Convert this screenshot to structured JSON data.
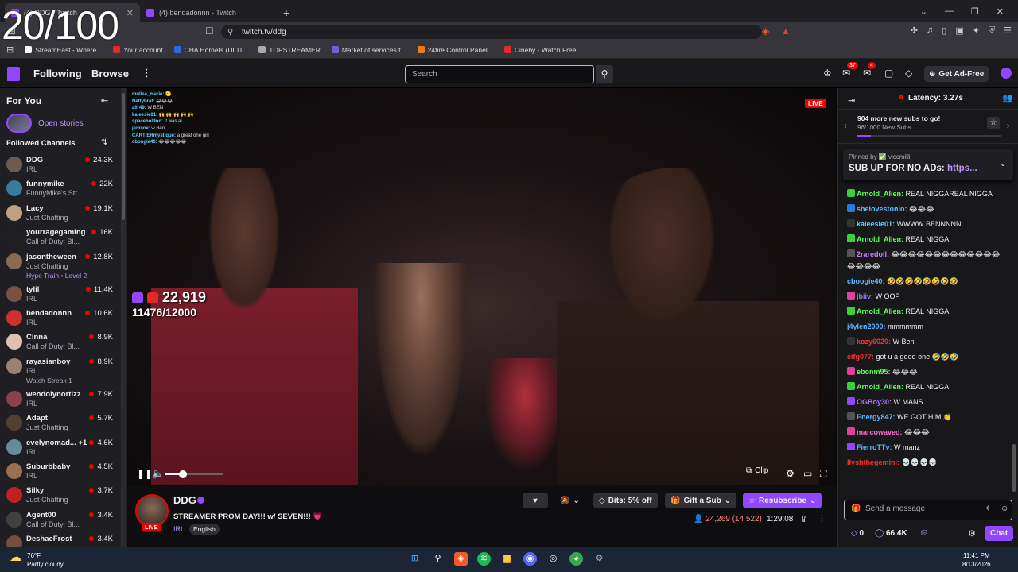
{
  "overlay_counter": "20/100",
  "browser": {
    "tabs": [
      {
        "label": "(4) DDG - Twitch",
        "active": true
      },
      {
        "label": "(4) bendadonnn - Twitch",
        "active": false
      }
    ],
    "new_tab": "+",
    "url": "twitch.tv/ddg",
    "bookmarks": [
      {
        "label": "StreamEast - Where...",
        "color": "#ffffff"
      },
      {
        "label": "Your account",
        "color": "#e52828"
      },
      {
        "label": "CHA Hornets (ULTI...",
        "color": "#2a6be0"
      },
      {
        "label": "TOPSTREAMER",
        "color": "#aaaaaa"
      },
      {
        "label": "Market of services f...",
        "color": "#7a5ae0"
      },
      {
        "label": "24fire Control Panel...",
        "color": "#f07a1a"
      },
      {
        "label": "Cineby - Watch Free...",
        "color": "#e52828"
      }
    ]
  },
  "topnav": {
    "following": "Following",
    "browse": "Browse",
    "more": "⋮",
    "search_placeholder": "Search",
    "notif_badge_1": "37",
    "notif_badge_2": "4",
    "ad_free": "Get Ad-Free"
  },
  "sidebar": {
    "for_you": "For You",
    "open_stories": "Open stories",
    "followed_channels": "Followed Channels",
    "channels": [
      {
        "name": "DDG",
        "game": "IRL",
        "viewers": "24.3K",
        "avatar_color": "#6a5a50"
      },
      {
        "name": "funnymike",
        "game": "FunnyMike's Str...",
        "viewers": "22K",
        "avatar_color": "#3a7a9a"
      },
      {
        "name": "Lacy",
        "game": "Just Chatting",
        "viewers": "19.1K",
        "avatar_color": "#c0a080"
      },
      {
        "name": "yourragegaming",
        "game": "Call of Duty: Bl...",
        "viewers": "16K",
        "avatar_color": "#202020"
      },
      {
        "name": "jasontheween",
        "game": "Just Chatting",
        "viewers": "12.8K",
        "avatar_color": "#8a6a50",
        "sub": "Hype Train • Level 2",
        "sub_purple": true
      },
      {
        "name": "tylil",
        "game": "IRL",
        "viewers": "11.4K",
        "avatar_color": "#7a5040"
      },
      {
        "name": "bendadonnn",
        "game": "IRL",
        "viewers": "10.6K",
        "avatar_color": "#d03030"
      },
      {
        "name": "Cinna",
        "game": "Call of Duty: Bl...",
        "viewers": "8.9K",
        "avatar_color": "#e0c0b0"
      },
      {
        "name": "rayasianboy",
        "game": "IRL",
        "viewers": "8.9K",
        "avatar_color": "#9a8070",
        "sub": "Watch Streak 1",
        "sub_purple": false
      },
      {
        "name": "wendolynortizz",
        "game": "IRL",
        "viewers": "7.9K",
        "avatar_color": "#8a4050"
      },
      {
        "name": "Adapt",
        "game": "Just Chatting",
        "viewers": "5.7K",
        "avatar_color": "#504030"
      },
      {
        "name": "evelynomad... +1",
        "game": "IRL",
        "viewers": "4.6K",
        "avatar_color": "#6a8a9a"
      },
      {
        "name": "Suburbbaby",
        "game": "IRL",
        "viewers": "4.5K",
        "avatar_color": "#9a7050"
      },
      {
        "name": "Silky",
        "game": "Just Chatting",
        "viewers": "3.7K",
        "avatar_color": "#c02020"
      },
      {
        "name": "Agent00",
        "game": "Call of Duty: Bl...",
        "viewers": "3.4K",
        "avatar_color": "#404040"
      },
      {
        "name": "DeshaeFrost",
        "game": "",
        "viewers": "3.4K",
        "avatar_color": "#705040"
      }
    ]
  },
  "video": {
    "live": "LIVE",
    "overlay_viewers": "22,919",
    "overlay_goal": "11476/12000",
    "overlay_chat": [
      {
        "user": "mulisa_marie:",
        "text": "🫡"
      },
      {
        "user": "Nettybrat:",
        "text": "😂😂😂"
      },
      {
        "user": "alir49:",
        "text": "W BEN"
      },
      {
        "user": "kaleesie01:",
        "text": "🙌 🙌 🙌 🙌 🙌"
      },
      {
        "user": "spaceholdon:",
        "text": "It was ai"
      },
      {
        "user": "jemijoe:",
        "text": "w Ben"
      },
      {
        "user": "CARTIERmystique:",
        "text": "a great one girl"
      },
      {
        "user": "cboogie40:",
        "text": "😂😂😂😂😂"
      }
    ],
    "volume_level": 0.3,
    "clip": "Clip"
  },
  "stream": {
    "name": "DDG",
    "live": "LIVE",
    "title": "STREAMER PROM DAY!!! w/ SEVEN!!! 💗",
    "category": "IRL",
    "language": "English",
    "bits": "Bits: 5% off",
    "gift": "Gift a Sub",
    "resubscribe": "Resubscribe",
    "viewers": "24,269 (14 522)",
    "uptime": "1:29:08"
  },
  "chat": {
    "latency": "Latency: 3.27s",
    "goal_title": "904 more new subs to go!",
    "goal_sub": "96/1000 New Subs",
    "goal_progress": 0.096,
    "pinned_by": "Pinned by ✅ viccmilli",
    "pinned_text": "SUB UP FOR NO ADs:",
    "pinned_link": "https...",
    "messages": [
      {
        "user": "Arnold_Alien:",
        "color": "#5cff5c",
        "text": "REAL NIGGAREAL NIGGA",
        "badge": "#3ad13a"
      },
      {
        "user": "shelovestonio:",
        "color": "#5ab8ff",
        "text": "😂😂😂",
        "badge": "#2a7ae0"
      },
      {
        "user": "kaleesie01:",
        "color": "#5ad3ff",
        "text": "WWWW BENNNNN",
        "badge": "#333333"
      },
      {
        "user": "Arnold_Alien:",
        "color": "#5cff5c",
        "text": "REAL NIGGA",
        "badge": "#3ad13a"
      },
      {
        "user": "2raredoll:",
        "color": "#d07aff",
        "text": "😂😂😂😂😂😂😂😂😂😂😂😂😂😂😂😂😂",
        "badge": "#555555"
      },
      {
        "user": "cboogie40:",
        "color": "#5ab8ff",
        "text": "🤣🤣🤣🤣🤣🤣🤣🤣",
        "badge": ""
      },
      {
        "user": "jbiiv:",
        "color": "#8a7aff",
        "text": "W OOP",
        "badge": "#e040a0"
      },
      {
        "user": "Arnold_Alien:",
        "color": "#5cff5c",
        "text": "REAL NIGGA",
        "badge": "#3ad13a"
      },
      {
        "user": "j4ylen2000:",
        "color": "#5ab8ff",
        "text": "mmmmmm",
        "badge": ""
      },
      {
        "user": "kozy6020:",
        "color": "#ff3030",
        "text": "W Ben",
        "badge": "#333333"
      },
      {
        "user": "cifg077:",
        "color": "#ff3030",
        "text": "got u a good one 🤣🤣🤣",
        "badge": ""
      },
      {
        "user": "ebonm95:",
        "color": "#5cff5c",
        "text": "😂😂😂",
        "badge": "#e040a0"
      },
      {
        "user": "Arnold_Alien:",
        "color": "#5cff5c",
        "text": "REAL NIGGA",
        "badge": "#3ad13a"
      },
      {
        "user": "OGBoy30:",
        "color": "#b07aff",
        "text": "W MANS",
        "badge": "#9147ff"
      },
      {
        "user": "Energy847:",
        "color": "#5ab8ff",
        "text": "WE GOT HIM 👏",
        "badge": "#555555"
      },
      {
        "user": "marcowaved:",
        "color": "#ff6ad5",
        "text": "😂😂😂",
        "badge": "#e040a0"
      },
      {
        "user": "FierroTTv:",
        "color": "#5ab8ff",
        "text": "W manz",
        "badge": "#9147ff"
      },
      {
        "user": "llyshthegemini:",
        "color": "#ff3030",
        "text": "💀💀💀💀",
        "badge": ""
      }
    ],
    "input_placeholder": "Send a message",
    "bits_count": "0",
    "points": "66.4K",
    "chat_button": "Chat"
  },
  "taskbar": {
    "temp": "76°F",
    "weather": "Partly cloudy",
    "time": "11:41 PM",
    "date": "8/13/2026"
  }
}
